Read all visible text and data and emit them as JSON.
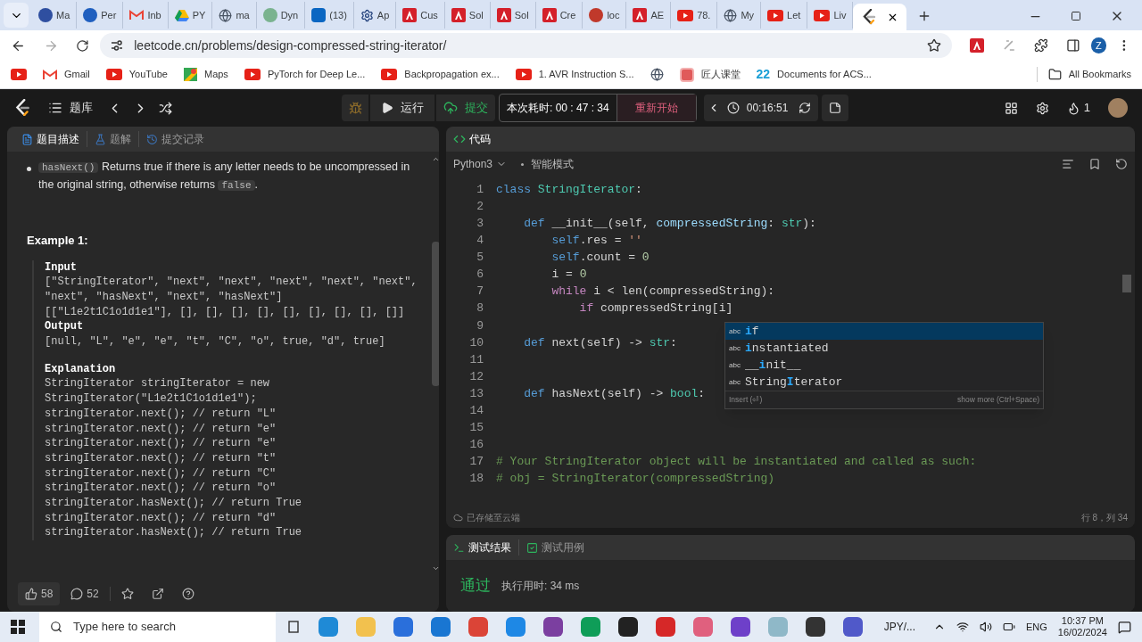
{
  "browser": {
    "tabs": [
      {
        "title": "Ma",
        "kind": "dot",
        "color": "#2f4fa0",
        "selected": false
      },
      {
        "title": "Per",
        "kind": "dot",
        "color": "#1f5fbf",
        "selected": false
      },
      {
        "title": "Inb",
        "kind": "gmail",
        "selected": false
      },
      {
        "title": "PY",
        "kind": "drive",
        "selected": false
      },
      {
        "title": "ma",
        "kind": "globe",
        "selected": false
      },
      {
        "title": "Dyn",
        "kind": "dot",
        "color": "#7ab38f",
        "selected": false
      },
      {
        "title": "(13)",
        "kind": "linkedin",
        "selected": false
      },
      {
        "title": "Ap",
        "kind": "gear",
        "selected": false
      },
      {
        "title": "Cus",
        "kind": "adobe",
        "selected": false
      },
      {
        "title": "Sol",
        "kind": "adobe",
        "selected": false
      },
      {
        "title": "Sol",
        "kind": "adobe",
        "selected": false
      },
      {
        "title": "Cre",
        "kind": "adobe",
        "selected": false
      },
      {
        "title": "loc",
        "kind": "dot",
        "color": "#c0392b",
        "selected": false
      },
      {
        "title": "AE",
        "kind": "adobe",
        "selected": false
      },
      {
        "title": "78.",
        "kind": "youtube",
        "selected": false
      },
      {
        "title": "My",
        "kind": "globe",
        "selected": false
      },
      {
        "title": "Let",
        "kind": "youtube",
        "selected": false
      },
      {
        "title": "Liv",
        "kind": "youtube",
        "selected": false
      },
      {
        "kind": "leetcode",
        "selected": true
      }
    ],
    "url": "leetcode.cn/problems/design-compressed-string-iterator/",
    "profile": "Z",
    "bookmarks": [
      {
        "kind": "youtube"
      },
      {
        "kind": "gmail",
        "label": "Gmail"
      },
      {
        "kind": "youtube",
        "label": "YouTube"
      },
      {
        "kind": "maps",
        "label": "Maps"
      },
      {
        "kind": "youtube",
        "label": "PyTorch for Deep Le..."
      },
      {
        "kind": "youtube",
        "label": "Backpropagation ex..."
      },
      {
        "kind": "youtube",
        "label": "1. AVR Instruction S..."
      },
      {
        "kind": "globe"
      },
      {
        "kind": "square",
        "label": "匠人课堂"
      },
      {
        "kind": "mark",
        "mark": "22",
        "label": "Documents for ACS..."
      }
    ],
    "all_bookmarks": "All Bookmarks"
  },
  "header": {
    "nav_title": "题库",
    "run": "运行",
    "submit": "提交",
    "elapsed": "本次耗时: 00 : 47 : 34",
    "restart": "重新开始",
    "timer": "00:16:51",
    "streak": "1"
  },
  "problem": {
    "tabs": [
      {
        "label": "题目描述",
        "selected": true
      },
      {
        "label": "题解",
        "selected": false
      },
      {
        "label": "提交记录",
        "selected": false
      }
    ],
    "description": [
      {
        "kind": "code",
        "text": "hasNext()"
      },
      {
        "kind": "text",
        "text": " Returns true if there is any letter needs to be uncompressed in the original string, otherwise returns "
      },
      {
        "kind": "code",
        "text": "false"
      },
      {
        "kind": "text",
        "text": "."
      }
    ],
    "example": {
      "title": "Example 1:",
      "sections": [
        {
          "label": "Input",
          "lines": [
            "[\"StringIterator\", \"next\", \"next\", \"next\", \"next\", \"next\",",
            "\"next\", \"hasNext\", \"next\", \"hasNext\"]",
            "[[\"L1e2t1C1o1d1e1\"], [], [], [], [], [], [], [], [], []]"
          ]
        },
        {
          "label": "Output",
          "lines": [
            "[null, \"L\", \"e\", \"e\", \"t\", \"C\", \"o\", true, \"d\", true]"
          ]
        },
        {
          "label": "Explanation",
          "lines": [
            "StringIterator stringIterator = new",
            "StringIterator(\"L1e2t1C1o1d1e1\");",
            "stringIterator.next(); // return \"L\"",
            "stringIterator.next(); // return \"e\"",
            "stringIterator.next(); // return \"e\"",
            "stringIterator.next(); // return \"t\"",
            "stringIterator.next(); // return \"C\"",
            "stringIterator.next(); // return \"o\"",
            "stringIterator.hasNext(); // return True",
            "stringIterator.next(); // return \"d\"",
            "stringIterator.hasNext(); // return True"
          ]
        }
      ]
    },
    "likes": "58",
    "comments": "52"
  },
  "editor": {
    "title": "代码",
    "language": "Python3",
    "mode": "智能模式",
    "lines": [
      {
        "number": "1",
        "segments": [
          {
            "kind": "kw",
            "text": "class "
          },
          {
            "kind": "cls",
            "text": "StringIterator"
          },
          {
            "kind": "plain",
            "text": ":"
          }
        ]
      },
      {
        "number": "2"
      },
      {
        "number": "3",
        "segments": [
          {
            "kind": "kw",
            "text": "    def "
          },
          {
            "kind": "plain",
            "text": "__init__(self, "
          },
          {
            "kind": "param",
            "text": "compressedString"
          },
          {
            "kind": "plain",
            "text": ": "
          },
          {
            "kind": "cls",
            "text": "str"
          },
          {
            "kind": "plain",
            "text": "):"
          }
        ]
      },
      {
        "number": "4",
        "segments": [
          {
            "kind": "self",
            "text": "        self"
          },
          {
            "kind": "plain",
            "text": ".res = "
          },
          {
            "kind": "str",
            "text": "''"
          }
        ]
      },
      {
        "number": "5",
        "segments": [
          {
            "kind": "self",
            "text": "        self"
          },
          {
            "kind": "plain",
            "text": ".count = "
          },
          {
            "kind": "num",
            "text": "0"
          }
        ]
      },
      {
        "number": "6",
        "segments": [
          {
            "kind": "plain",
            "text": "        i = "
          },
          {
            "kind": "num",
            "text": "0"
          }
        ]
      },
      {
        "number": "7",
        "segments": [
          {
            "kind": "ctrl",
            "text": "        while"
          },
          {
            "kind": "plain",
            "text": " i < len(compressedString):"
          }
        ]
      },
      {
        "number": "8",
        "segments": [
          {
            "kind": "ctrl",
            "text": "            if"
          },
          {
            "kind": "plain",
            "text": " compressedString[i]"
          }
        ]
      },
      {
        "number": "9"
      },
      {
        "number": "10",
        "segments": [
          {
            "kind": "kw",
            "text": "    def "
          },
          {
            "kind": "plain",
            "text": "next(self) -> "
          },
          {
            "kind": "cls",
            "text": "str"
          },
          {
            "kind": "plain",
            "text": ":"
          }
        ]
      },
      {
        "number": "11"
      },
      {
        "number": "12"
      },
      {
        "number": "13",
        "segments": [
          {
            "kind": "kw",
            "text": "    def "
          },
          {
            "kind": "plain",
            "text": "hasNext(self) -> "
          },
          {
            "kind": "cls",
            "text": "bool"
          },
          {
            "kind": "plain",
            "text": ":"
          }
        ]
      },
      {
        "number": "14"
      },
      {
        "number": "15"
      },
      {
        "number": "16"
      },
      {
        "number": "17",
        "segments": [
          {
            "kind": "comment",
            "text": "# Your StringIterator object will be instantiated and called as such:"
          }
        ]
      },
      {
        "number": "18",
        "segments": [
          {
            "kind": "comment",
            "text": "# obj = StringIterator(compressedString)"
          }
        ]
      }
    ],
    "suggestions": {
      "items": [
        {
          "symbol": "abc",
          "match": "i",
          "after": "f",
          "selected": true
        },
        {
          "symbol": "abc",
          "match": "i",
          "after": "nstantiated",
          "selected": false
        },
        {
          "symbol": "abc",
          "before": "__",
          "match": "i",
          "after": "nit__",
          "selected": false
        },
        {
          "symbol": "abc",
          "before": "String",
          "match": "I",
          "after": "terator",
          "selected": false
        }
      ],
      "hint_left": "Insert (⏎)",
      "hint_right": "show more (Ctrl+Space)"
    },
    "saved": "已存储至云端",
    "position": "行 8，列 34"
  },
  "results": {
    "tabs": [
      {
        "label": "测试结果",
        "selected": true
      },
      {
        "label": "测试用例",
        "selected": false
      }
    ],
    "verdict": "通过",
    "runtime": "执行用时: 34 ms"
  },
  "taskbar": {
    "search_placeholder": "Type here to search",
    "apps": [
      {
        "color": "#1f8ad6"
      },
      {
        "color": "#f2c14e"
      },
      {
        "color": "#2a6fdb"
      },
      {
        "color": "#1976d2"
      },
      {
        "color": "#db4437"
      },
      {
        "color": "#1e88e5"
      },
      {
        "color": "#7b3fa0"
      },
      {
        "color": "#0f9d58"
      },
      {
        "color": "#222222"
      },
      {
        "color": "#d62828"
      },
      {
        "color": "#e0607e"
      },
      {
        "color": "#6e40c9"
      },
      {
        "color": "#8fb8c8"
      },
      {
        "color": "#333333"
      },
      {
        "color": "#5059c9"
      }
    ],
    "tray_app": "JPY/...",
    "language": "ENG",
    "time": "10:37 PM",
    "date": "16/02/2024"
  }
}
